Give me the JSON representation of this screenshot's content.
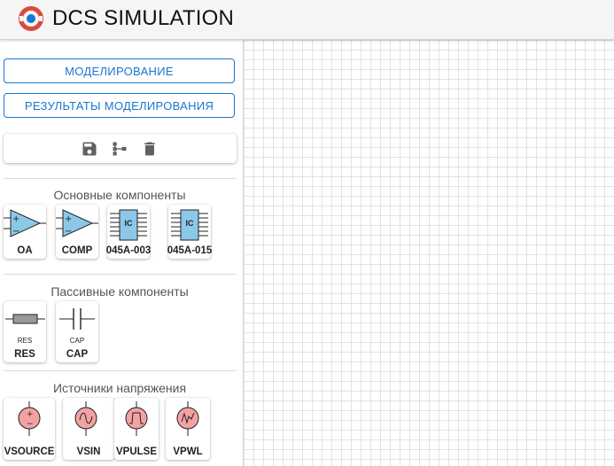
{
  "header": {
    "title": "DCS SIMULATION",
    "logo_icon": "dcs-logo-icon",
    "accent": "#1976d2",
    "logo_color": "#d84b40"
  },
  "sidebar": {
    "simulate_label": "МОДЕЛИРОВАНИЕ",
    "results_label": "РЕЗУЛЬТАТЫ МОДЕЛИРОВАНИЯ",
    "toolbar": {
      "icons": [
        "save-icon",
        "tree-structure-icon",
        "delete-icon"
      ]
    },
    "sections": {
      "basic": {
        "title": "Основные компоненты",
        "items": [
          {
            "label": "OA",
            "icon": "op-amp-icon"
          },
          {
            "label": "COMP",
            "icon": "comparator-icon"
          },
          {
            "label": "045A-003",
            "icon": "ic-chip-icon",
            "chip_text": "IC"
          },
          {
            "label": "045A-015",
            "icon": "ic-chip-icon",
            "chip_text": "IC"
          }
        ]
      },
      "passive": {
        "title": "Пассивные компоненты",
        "items": [
          {
            "label": "RES",
            "icon": "resistor-icon",
            "sub": "RES"
          },
          {
            "label": "CAP",
            "icon": "capacitor-icon",
            "sub": "CAP"
          }
        ]
      },
      "sources": {
        "title": "Источники напряжения",
        "items": [
          {
            "label": "VSOURCE",
            "icon": "dc-voltage-source-icon"
          },
          {
            "label": "VSIN",
            "icon": "sine-voltage-source-icon"
          },
          {
            "label": "VPULSE",
            "icon": "pulse-voltage-source-icon"
          },
          {
            "label": "VPWL",
            "icon": "pwl-voltage-source-icon"
          }
        ]
      }
    }
  }
}
